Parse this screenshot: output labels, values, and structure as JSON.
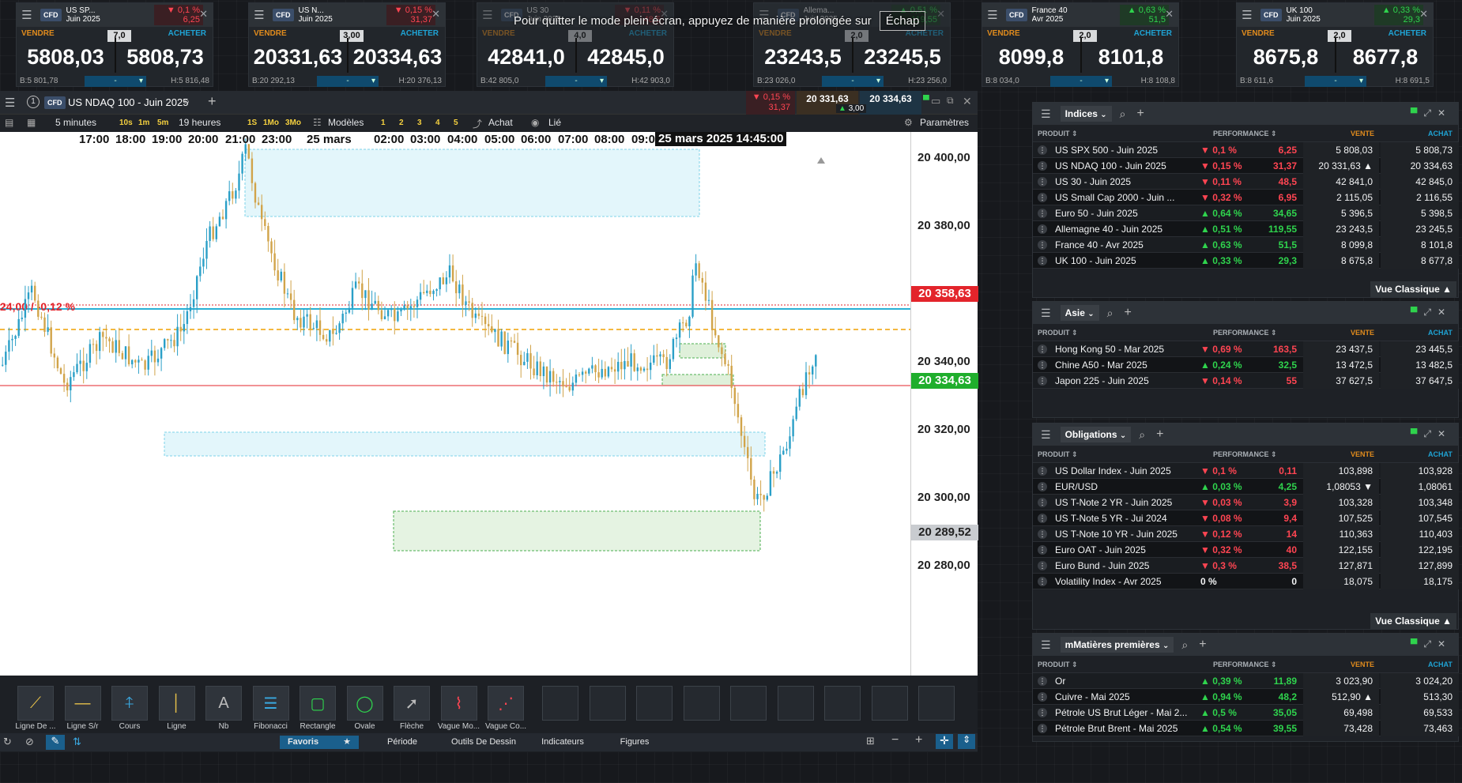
{
  "app": {
    "fullscreen_notice": "Pour quitter le mode plein écran, appuyez de manière prolongée sur",
    "escape_key": "Échap"
  },
  "tickers": [
    {
      "name1": "US SP...",
      "name2": "Juin 2025",
      "perf": "▼ 0,1 %",
      "chg": "6,25",
      "dir": "dn",
      "spread": "7,0",
      "sell": "5808,03",
      "buy": "5808,73",
      "low": "B:5 801,78",
      "high": "H:5 816,48",
      "qty": "-",
      "sell_label": "VENDRE",
      "buy_label": "ACHETER"
    },
    {
      "name1": "US N...",
      "name2": "Juin 2025",
      "perf": "▼ 0,15 %",
      "chg": "31,37",
      "dir": "dn",
      "spread": "3,00",
      "sell": "20331,63",
      "buy": "20334,63",
      "low": "B:20 292,13",
      "high": "H:20 376,13",
      "qty": "-",
      "sell_label": "VENDRE",
      "buy_label": "ACHETER"
    },
    {
      "name1": "US 30",
      "name2": "Juin 2025",
      "perf": "▼ 0,11 %",
      "chg": "48,5",
      "dir": "dn",
      "spread": "4,0",
      "sell": "42841,0",
      "buy": "42845,0",
      "low": "B:42 805,0",
      "high": "H:42 903,0",
      "qty": "-",
      "sell_label": "VENDRE",
      "buy_label": "ACHETER"
    },
    {
      "name1": "Allema...",
      "name2": "Juin 2025",
      "perf": "▲ 0,51 %",
      "chg": "119,55",
      "dir": "up",
      "spread": "2,0",
      "sell": "23243,5",
      "buy": "23245,5",
      "low": "B:23 026,0",
      "high": "H:23 256,0",
      "qty": "-",
      "sell_label": "VENDRE",
      "buy_label": "ACHETER"
    },
    {
      "name1": "France 40",
      "name2": "Avr 2025",
      "perf": "▲ 0,63 %",
      "chg": "51,5",
      "dir": "up",
      "spread": "2,0",
      "sell": "8099,8",
      "buy": "8101,8",
      "low": "B:8 034,0",
      "high": "H:8 108,8",
      "qty": "-",
      "sell_label": "VENDRE",
      "buy_label": "ACHETER"
    },
    {
      "name1": "UK 100",
      "name2": "Juin 2025",
      "perf": "▲ 0,33 %",
      "chg": "29,3",
      "dir": "up",
      "spread": "2,0",
      "sell": "8675,8",
      "buy": "8677,8",
      "low": "B:8 611,6",
      "high": "H:8 691,5",
      "qty": "-",
      "sell_label": "VENDRE",
      "buy_label": "ACHETER"
    }
  ],
  "chart": {
    "title": "US NDAQ 100 - Juin 2025",
    "window_number": "1",
    "perf": "▼ 0,15 %",
    "perf_chg": "31,37",
    "sell_price": "20 331,63",
    "buy_price": "20 334,63",
    "spread": "3,00",
    "toolbar": {
      "timeframe": "5 minutes",
      "tf_buttons": [
        "10s",
        "1m",
        "5m"
      ],
      "range": "19 heures",
      "range_buttons": [
        "1S",
        "1Mo",
        "3Mo"
      ],
      "templates": "Modèles",
      "numbers": [
        "1",
        "2",
        "3",
        "4",
        "5"
      ],
      "buy": "Achat",
      "linked": "Lié",
      "settings": "Paramètres"
    },
    "time_labels": [
      "17:00",
      "18:00",
      "19:00",
      "20:00",
      "21:00",
      "23:00",
      "25 mars",
      "02:00",
      "03:00",
      "04:00",
      "05:00",
      "06:00",
      "07:00",
      "08:00",
      "09:00"
    ],
    "current_time": "25 mars 2025 14:45:00",
    "price_labels": [
      "20 400,00",
      "20 380,00",
      "20 340,00",
      "20 320,00",
      "20 300,00",
      "20 280,00"
    ],
    "tag_red": "20 358,63",
    "tag_green": "20 334,63",
    "tag_grey": "20 289,52",
    "line_annotation": "24,00 / -0,12 %",
    "draw_tools": [
      "Ligne De ...",
      "Ligne S/r",
      "Cours",
      "Ligne",
      "Nb",
      "Fibonacci",
      "Rectangle",
      "Ovale",
      "Flèche",
      "Vague Mo...",
      "Vague Co..."
    ],
    "tabs": [
      "Favoris",
      "Période",
      "Outils De Dessin",
      "Indicateurs",
      "Figures"
    ]
  },
  "watchlists": {
    "indices": {
      "title": "Indices",
      "cols": {
        "product": "PRODUIT",
        "perf": "PERFORMANCE",
        "sell": "VENTE",
        "buy": "ACHAT"
      },
      "rows": [
        {
          "name": "US SPX 500 - Juin 2025",
          "perf": "▼ 0,1 %",
          "chg": "6,25",
          "dir": "dn",
          "sell": "5 808,03",
          "buy": "5 808,73"
        },
        {
          "name": "US NDAQ 100 - Juin 2025",
          "perf": "▼ 0,15 %",
          "chg": "31,37",
          "dir": "dn",
          "sell": "20 331,63 ▲",
          "buy": "20 334,63"
        },
        {
          "name": "US 30 - Juin 2025",
          "perf": "▼ 0,11 %",
          "chg": "48,5",
          "dir": "dn",
          "sell": "42 841,0",
          "buy": "42 845,0"
        },
        {
          "name": "US Small Cap 2000 - Juin ...",
          "perf": "▼ 0,32 %",
          "chg": "6,95",
          "dir": "dn",
          "sell": "2 115,05",
          "buy": "2 116,55"
        },
        {
          "name": "Euro 50 - Juin 2025",
          "perf": "▲ 0,64 %",
          "chg": "34,65",
          "dir": "up",
          "sell": "5 396,5",
          "buy": "5 398,5"
        },
        {
          "name": "Allemagne 40 - Juin 2025",
          "perf": "▲ 0,51 %",
          "chg": "119,55",
          "dir": "up",
          "sell": "23 243,5",
          "buy": "23 245,5"
        },
        {
          "name": "France 40 - Avr 2025",
          "perf": "▲ 0,63 %",
          "chg": "51,5",
          "dir": "up",
          "sell": "8 099,8",
          "buy": "8 101,8"
        },
        {
          "name": "UK 100 - Juin 2025",
          "perf": "▲ 0,33 %",
          "chg": "29,3",
          "dir": "up",
          "sell": "8 675,8",
          "buy": "8 677,8"
        }
      ],
      "vue": "Vue Classique ▲"
    },
    "asie": {
      "title": "Asie",
      "cols": {
        "product": "PRODUIT",
        "perf": "PERFORMANCE",
        "sell": "VENTE",
        "buy": "ACHAT"
      },
      "rows": [
        {
          "name": "Hong Kong 50 - Mar 2025",
          "perf": "▼ 0,69 %",
          "chg": "163,5",
          "dir": "dn",
          "sell": "23 437,5",
          "buy": "23 445,5"
        },
        {
          "name": "Chine A50 - Mar 2025",
          "perf": "▲ 0,24 %",
          "chg": "32,5",
          "dir": "up",
          "sell": "13 472,5",
          "buy": "13 482,5"
        },
        {
          "name": "Japon 225 - Juin 2025",
          "perf": "▼ 0,14 %",
          "chg": "55",
          "dir": "dn",
          "sell": "37 627,5",
          "buy": "37 647,5"
        }
      ]
    },
    "obligations": {
      "title": "Obligations",
      "cols": {
        "product": "PRODUIT",
        "perf": "PERFORMANCE",
        "sell": "VENTE",
        "buy": "ACHAT"
      },
      "rows": [
        {
          "name": "US Dollar Index - Juin 2025",
          "perf": "▼ 0,1 %",
          "chg": "0,11",
          "dir": "dn",
          "sell": "103,898",
          "buy": "103,928"
        },
        {
          "name": "EUR/USD",
          "perf": "▲ 0,03 %",
          "chg": "4,25",
          "dir": "up",
          "sell": "1,08053 ▼",
          "buy": "1,08061"
        },
        {
          "name": "US T-Note 2 YR - Juin 2025",
          "perf": "▼ 0,03 %",
          "chg": "3,9",
          "dir": "dn",
          "sell": "103,328",
          "buy": "103,348"
        },
        {
          "name": "US T-Note 5 YR - Jui 2024",
          "perf": "▼ 0,08 %",
          "chg": "9,4",
          "dir": "dn",
          "sell": "107,525",
          "buy": "107,545"
        },
        {
          "name": "US T-Note 10 YR - Juin 2025",
          "perf": "▼ 0,12 %",
          "chg": "14",
          "dir": "dn",
          "sell": "110,363",
          "buy": "110,403"
        },
        {
          "name": "Euro OAT - Juin 2025",
          "perf": "▼ 0,32 %",
          "chg": "40",
          "dir": "dn",
          "sell": "122,155",
          "buy": "122,195"
        },
        {
          "name": "Euro Bund - Juin 2025",
          "perf": "▼ 0,3 %",
          "chg": "38,5",
          "dir": "dn",
          "sell": "127,871",
          "buy": "127,899"
        },
        {
          "name": "Volatility Index - Avr 2025",
          "perf": "0 %",
          "chg": "0",
          "dir": "neu",
          "sell": "18,075",
          "buy": "18,175"
        }
      ],
      "vue": "Vue Classique ▲"
    },
    "matieres": {
      "title": "mMatières premières",
      "cols": {
        "product": "PRODUIT",
        "perf": "PERFORMANCE",
        "sell": "VENTE",
        "buy": "ACHAT"
      },
      "rows": [
        {
          "name": "Or",
          "perf": "▲ 0,39 %",
          "chg": "11,89",
          "dir": "up",
          "sell": "3 023,90",
          "buy": "3 024,20"
        },
        {
          "name": "Cuivre - Mai 2025",
          "perf": "▲ 0,94 %",
          "chg": "48,2",
          "dir": "up",
          "sell": "512,90 ▲",
          "buy": "513,30"
        },
        {
          "name": "Pétrole US Brut Léger - Mai 2...",
          "perf": "▲ 0,5 %",
          "chg": "35,05",
          "dir": "up",
          "sell": "69,498",
          "buy": "69,533"
        },
        {
          "name": "Pétrole Brut Brent - Mai 2025",
          "perf": "▲ 0,54 %",
          "chg": "39,55",
          "dir": "up",
          "sell": "73,428",
          "buy": "73,463"
        }
      ]
    }
  },
  "colors": {
    "up": "#2fd34d",
    "down": "#ff4552",
    "candle_up": "#2a9fc7",
    "candle_down": "#d1a44a",
    "sell_label": "#e08b1d",
    "buy_label": "#1fa3d4"
  }
}
